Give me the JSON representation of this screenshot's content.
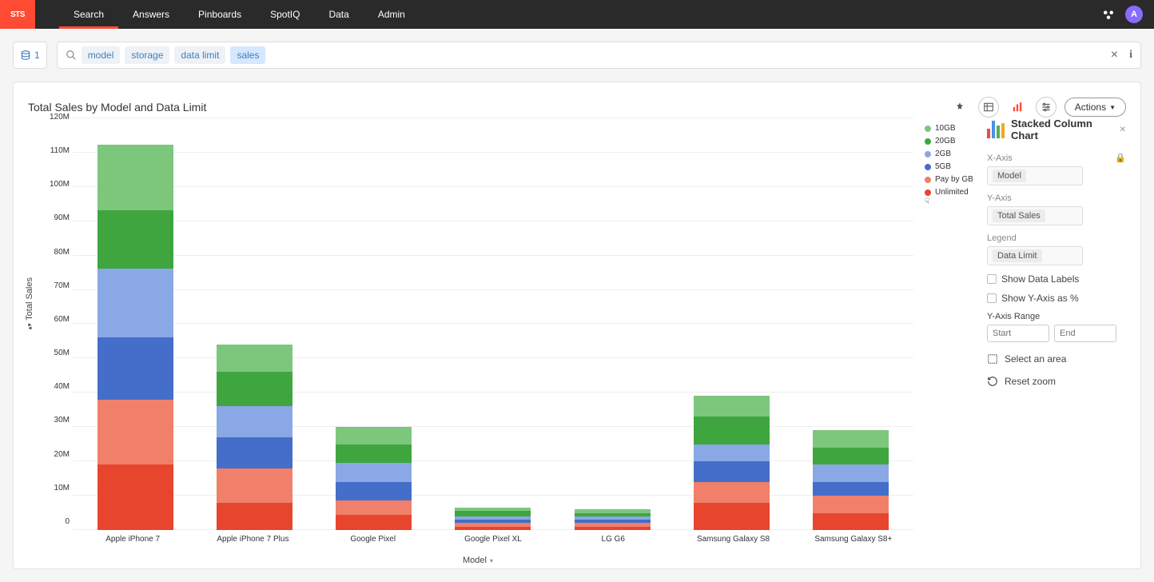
{
  "brand": "STS",
  "nav": {
    "items": [
      {
        "label": "Search",
        "active": true
      },
      {
        "label": "Answers",
        "active": false
      },
      {
        "label": "Pinboards",
        "active": false
      },
      {
        "label": "SpotIQ",
        "active": false
      },
      {
        "label": "Data",
        "active": false
      },
      {
        "label": "Admin",
        "active": false
      }
    ],
    "avatar": "A"
  },
  "search_bar": {
    "source_count": "1",
    "tokens": [
      "model",
      "storage",
      "data limit",
      "sales"
    ],
    "highlight_index": 3
  },
  "panel": {
    "title": "Total Sales by Model and Data Limit",
    "actions_button": "Actions"
  },
  "config": {
    "title": "Stacked Column Chart",
    "xaxis_label": "X-Axis",
    "xaxis_value": "Model",
    "yaxis_label": "Y-Axis",
    "yaxis_value": "Total Sales",
    "legend_label": "Legend",
    "legend_value": "Data Limit",
    "show_data_labels": "Show Data Labels",
    "show_y_pct": "Show Y-Axis as %",
    "yaxis_range_label": "Y-Axis Range",
    "range_start_placeholder": "Start",
    "range_end_placeholder": "End",
    "select_area": "Select an area",
    "reset_zoom": "Reset zoom",
    "lock_tooltip": "locked"
  },
  "colors": {
    "10GB": "#7dc77d",
    "20GB": "#3fa63f",
    "2GB": "#8aa8e6",
    "5GB": "#446ec9",
    "Pay by GB": "#f0806a",
    "Unlimited": "#e8452e"
  },
  "chart_data": {
    "type": "stackedbar",
    "title": "Total Sales by Model and Data Limit",
    "xlabel": "Model",
    "ylabel": "Total Sales",
    "ylim": [
      0,
      120000000
    ],
    "ytick_labels": [
      "120M",
      "110M",
      "100M",
      "90M",
      "80M",
      "70M",
      "60M",
      "50M",
      "40M",
      "30M",
      "20M",
      "10M",
      "0"
    ],
    "categories": [
      "Apple iPhone 7",
      "Apple iPhone 7 Plus",
      "Google Pixel",
      "Google Pixel XL",
      "LG G6",
      "Samsung Galaxy S8",
      "Samsung Galaxy S8+"
    ],
    "legend_order": [
      "10GB",
      "20GB",
      "2GB",
      "5GB",
      "Pay by GB",
      "Unlimited"
    ],
    "series": [
      {
        "name": "Unlimited",
        "values": [
          19000000,
          8000000,
          4500000,
          1000000,
          1000000,
          8000000,
          5000000
        ]
      },
      {
        "name": "Pay by GB",
        "values": [
          19000000,
          10000000,
          4000000,
          1000000,
          1000000,
          6000000,
          5000000
        ]
      },
      {
        "name": "5GB",
        "values": [
          18000000,
          9000000,
          5500000,
          1000000,
          1000000,
          6000000,
          4000000
        ]
      },
      {
        "name": "2GB",
        "values": [
          20000000,
          9000000,
          5500000,
          1000000,
          1000000,
          5000000,
          5000000
        ]
      },
      {
        "name": "20GB",
        "values": [
          17000000,
          10000000,
          5500000,
          1500000,
          1000000,
          8000000,
          5000000
        ]
      },
      {
        "name": "10GB",
        "values": [
          19000000,
          8000000,
          5000000,
          1000000,
          1000000,
          6000000,
          5000000
        ]
      }
    ]
  }
}
